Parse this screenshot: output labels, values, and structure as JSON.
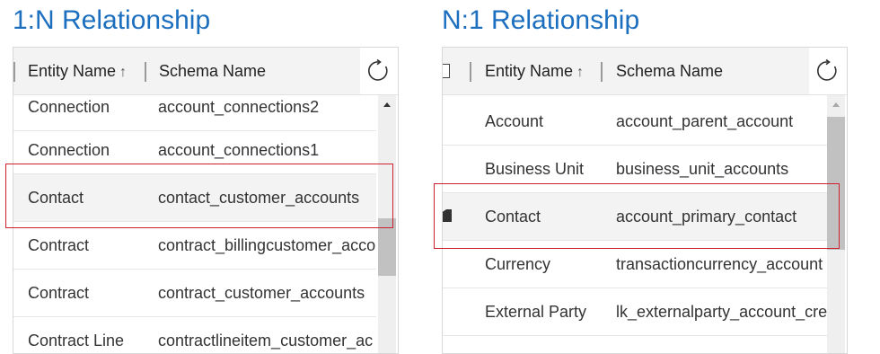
{
  "left_panel": {
    "title": "1:N Relationship",
    "headers": {
      "entity": "Entity Name",
      "sort_glyph": "↑",
      "schema": "Schema Name"
    },
    "refresh_icon": "refresh-icon",
    "rows": [
      {
        "entity": "Connection",
        "schema": "account_connections2"
      },
      {
        "entity": "Connection",
        "schema": "account_connections1"
      },
      {
        "entity": "Contact",
        "schema": "contact_customer_accounts",
        "selected": true
      },
      {
        "entity": "Contract",
        "schema": "contract_billingcustomer_acco"
      },
      {
        "entity": "Contract",
        "schema": "contract_customer_accounts"
      },
      {
        "entity": "Contract Line",
        "schema": "contractlineitem_customer_ac"
      }
    ]
  },
  "right_panel": {
    "title": "N:1 Relationship",
    "headers": {
      "entity": "Entity Name",
      "sort_glyph": "↑",
      "schema": "Schema Name"
    },
    "refresh_icon": "refresh-icon",
    "rows": [
      {
        "entity": "Account",
        "schema": "account_parent_account"
      },
      {
        "entity": "Business Unit",
        "schema": "business_unit_accounts"
      },
      {
        "entity": "Contact",
        "schema": "account_primary_contact",
        "selected": true
      },
      {
        "entity": "Currency",
        "schema": "transactioncurrency_account"
      },
      {
        "entity": "External Party",
        "schema": "lk_externalparty_account_cre"
      }
    ]
  },
  "colors": {
    "title": "#1c6fbf",
    "highlight": "#d0202f",
    "selected_row": "#f3f3f3"
  }
}
